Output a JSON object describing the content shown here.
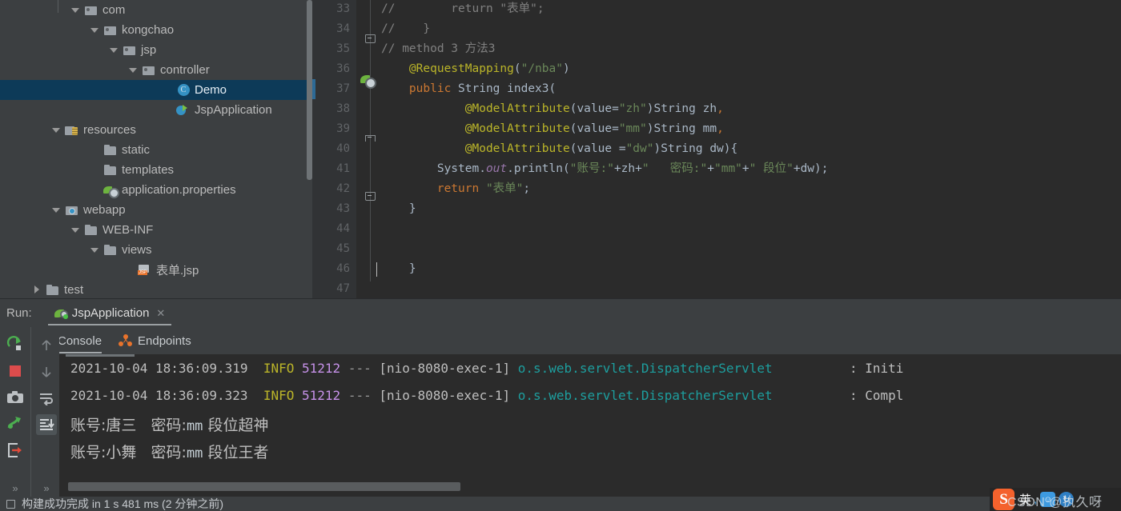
{
  "sidebar": {
    "name": "project-tree",
    "items": [
      {
        "label": "com",
        "indent": 88,
        "arrow": "down",
        "icon": "package-folder-icon",
        "selected": false
      },
      {
        "label": "kongchao",
        "indent": 112,
        "arrow": "down",
        "icon": "package-folder-icon",
        "selected": false
      },
      {
        "label": "jsp",
        "indent": 136,
        "arrow": "down",
        "icon": "package-folder-icon",
        "selected": false
      },
      {
        "label": "controller",
        "indent": 160,
        "arrow": "down",
        "icon": "package-folder-icon",
        "selected": false
      },
      {
        "label": "Demo",
        "indent": 203,
        "arrow": "none",
        "icon": "java-class-icon",
        "selected": true
      },
      {
        "label": "JspApplication",
        "indent": 203,
        "arrow": "none",
        "icon": "spring-boot-run-icon",
        "selected": false
      },
      {
        "label": "resources",
        "indent": 64,
        "arrow": "down",
        "icon": "resources-folder-icon",
        "selected": false
      },
      {
        "label": "static",
        "indent": 112,
        "arrow": "none",
        "icon": "folder-icon",
        "selected": false
      },
      {
        "label": "templates",
        "indent": 112,
        "arrow": "none",
        "icon": "folder-icon",
        "selected": false
      },
      {
        "label": "application.properties",
        "indent": 112,
        "arrow": "none",
        "icon": "spring-leaf-icon",
        "selected": false
      },
      {
        "label": "webapp",
        "indent": 64,
        "arrow": "down",
        "icon": "webapp-folder-icon",
        "selected": false
      },
      {
        "label": "WEB-INF",
        "indent": 88,
        "arrow": "down",
        "icon": "folder-icon",
        "selected": false
      },
      {
        "label": "views",
        "indent": 112,
        "arrow": "down",
        "icon": "folder-icon",
        "selected": false
      },
      {
        "label": "表单.jsp",
        "indent": 155,
        "arrow": "none",
        "icon": "jsp-file-icon",
        "selected": false
      },
      {
        "label": "test",
        "indent": 40,
        "arrow": "right",
        "icon": "folder-icon",
        "selected": false
      }
    ]
  },
  "editor": {
    "name": "code-editor",
    "first_visible_line": 33,
    "line_numbers": [
      33,
      34,
      35,
      36,
      37,
      38,
      39,
      40,
      41,
      42,
      43,
      44,
      45,
      46,
      47
    ],
    "gutter_bean_line": 37,
    "lines": [
      {
        "n": 33,
        "tokens": [
          {
            "t": "//        return \"表单\";",
            "c": "cm"
          }
        ]
      },
      {
        "n": 34,
        "tokens": [
          {
            "t": "//    }",
            "c": "cm"
          }
        ]
      },
      {
        "n": 35,
        "tokens": [
          {
            "t": "// method 3 方法3",
            "c": "cm"
          }
        ]
      },
      {
        "n": 36,
        "tokens": [
          {
            "t": "    ",
            "c": "pn"
          },
          {
            "t": "@RequestMapping",
            "c": "an"
          },
          {
            "t": "(",
            "c": "pn"
          },
          {
            "t": "\"/nba\"",
            "c": "st"
          },
          {
            "t": ")",
            "c": "pn"
          }
        ]
      },
      {
        "n": 37,
        "tokens": [
          {
            "t": "    ",
            "c": "pn"
          },
          {
            "t": "public ",
            "c": "k"
          },
          {
            "t": "String ",
            "c": "ty"
          },
          {
            "t": "index3",
            "c": "ty"
          },
          {
            "t": "(",
            "c": "pn"
          }
        ]
      },
      {
        "n": 38,
        "tokens": [
          {
            "t": "            ",
            "c": "pn"
          },
          {
            "t": "@ModelAttribute",
            "c": "an"
          },
          {
            "t": "(value=",
            "c": "pn"
          },
          {
            "t": "\"zh\"",
            "c": "st"
          },
          {
            "t": ")String zh",
            "c": "pn"
          },
          {
            "t": ",",
            "c": "k"
          }
        ]
      },
      {
        "n": 39,
        "tokens": [
          {
            "t": "            ",
            "c": "pn"
          },
          {
            "t": "@ModelAttribute",
            "c": "an"
          },
          {
            "t": "(value=",
            "c": "pn"
          },
          {
            "t": "\"mm\"",
            "c": "st"
          },
          {
            "t": ")String mm",
            "c": "pn"
          },
          {
            "t": ",",
            "c": "k"
          }
        ]
      },
      {
        "n": 40,
        "tokens": [
          {
            "t": "            ",
            "c": "pn"
          },
          {
            "t": "@ModelAttribute",
            "c": "an"
          },
          {
            "t": "(value =",
            "c": "pn"
          },
          {
            "t": "\"dw\"",
            "c": "st"
          },
          {
            "t": ")String dw){",
            "c": "pn"
          }
        ]
      },
      {
        "n": 41,
        "tokens": [
          {
            "t": "        System.",
            "c": "pn"
          },
          {
            "t": "out",
            "c": "it"
          },
          {
            "t": ".println(",
            "c": "pn"
          },
          {
            "t": "\"账号:\"",
            "c": "st"
          },
          {
            "t": "+zh+",
            "c": "pn"
          },
          {
            "t": "\"   密码:\"",
            "c": "st"
          },
          {
            "t": "+",
            "c": "pn"
          },
          {
            "t": "\"mm\"",
            "c": "st"
          },
          {
            "t": "+",
            "c": "pn"
          },
          {
            "t": "\" 段位\"",
            "c": "st"
          },
          {
            "t": "+dw);",
            "c": "pn"
          }
        ]
      },
      {
        "n": 42,
        "tokens": [
          {
            "t": "        ",
            "c": "pn"
          },
          {
            "t": "return ",
            "c": "k"
          },
          {
            "t": "\"表单\"",
            "c": "st"
          },
          {
            "t": ";",
            "c": "pn"
          }
        ]
      },
      {
        "n": 43,
        "tokens": [
          {
            "t": "    }",
            "c": "pn"
          }
        ]
      },
      {
        "n": 44,
        "tokens": []
      },
      {
        "n": 45,
        "tokens": []
      },
      {
        "n": 46,
        "tokens": [
          {
            "t": "    }",
            "c": "pn"
          }
        ]
      },
      {
        "n": 47,
        "tokens": []
      }
    ]
  },
  "run": {
    "label": "Run:",
    "tab_title": "JspApplication",
    "tab_close": "✕",
    "tab_icon": "spring-boot-run-icon",
    "subtabs": [
      {
        "label": "Console",
        "icon": "console-icon",
        "active": true
      },
      {
        "label": "Endpoints",
        "icon": "endpoints-icon",
        "active": false
      }
    ],
    "toolbar": [
      {
        "name": "rerun-button",
        "icon": "rerun-icon"
      },
      {
        "name": "stop-button",
        "icon": "stop-icon"
      },
      {
        "name": "thread-dump-button",
        "icon": "camera-icon"
      },
      {
        "name": "resume-program-button",
        "icon": "resume-icon"
      },
      {
        "name": "exit-button",
        "icon": "exit-icon"
      },
      {
        "name": "expand-toolbar",
        "icon": "chevrons-right-icon"
      }
    ],
    "toolbar2": [
      {
        "name": "up-button",
        "icon": "arrow-up-icon",
        "selected": false
      },
      {
        "name": "down-button",
        "icon": "arrow-down-icon",
        "selected": false
      },
      {
        "name": "soft-wrap-button",
        "icon": "soft-wrap-icon",
        "selected": false
      },
      {
        "name": "scroll-to-end-button",
        "icon": "scroll-to-end-icon",
        "selected": true
      },
      {
        "name": "expand-toolbar2",
        "icon": "chevrons-right-icon",
        "selected": false
      }
    ]
  },
  "console": {
    "log_lines": [
      {
        "date": "2021-10-04 18:36:09.319",
        "level": "INFO",
        "pid": "51212",
        "dashes": "---",
        "thread": "[nio-8080-exec-1]",
        "logger": "o.s.web.servlet.DispatcherServlet",
        "separator": ":",
        "message": "Initi"
      },
      {
        "date": "2021-10-04 18:36:09.323",
        "level": "INFO",
        "pid": "51212",
        "dashes": "---",
        "thread": "[nio-8080-exec-1]",
        "logger": "o.s.web.servlet.DispatcherServlet",
        "separator": ":",
        "message": "Compl"
      }
    ],
    "program_output": [
      {
        "account_label": "账号:",
        "account": "唐三",
        "pwd_label": "密码:",
        "pwd": "mm",
        "rank": "段位超神"
      },
      {
        "account_label": "账号:",
        "account": "小舞",
        "pwd_label": "密码:",
        "pwd": "mm",
        "rank": "段位王者"
      }
    ]
  },
  "status_bar": {
    "text": "构建成功完成 in 1 s 481 ms (2 分钟之前)",
    "icon": "build-icon"
  },
  "ime": {
    "logo": "S",
    "mode": "英",
    "comma": ",",
    "emoji": "☺",
    "menu": "↻",
    "watermark": "CSDN @执久呀"
  },
  "colors": {
    "editor_bg": "#2b2b2b",
    "panel_bg": "#3c3f41",
    "gutter_bg": "#313335",
    "selection": "#0d3a58",
    "keyword": "#cc7832",
    "string": "#6a8759",
    "annotation": "#bbb529",
    "comment": "#808080",
    "logger_teal": "#1d9e9e",
    "pid_purple": "#c792ea",
    "accent_orange": "#e8732c",
    "spring_green": "#6db33f"
  }
}
